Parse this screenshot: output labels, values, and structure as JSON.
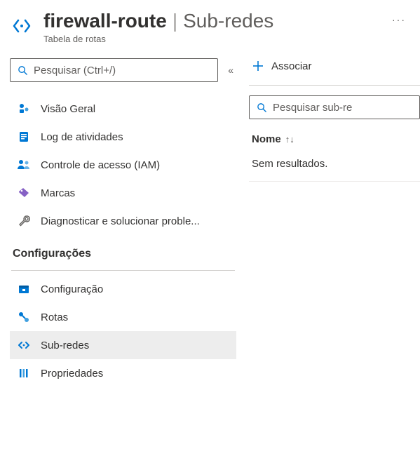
{
  "header": {
    "resource_name": "firewall-route",
    "separator": "|",
    "section": "Sub-redes",
    "subtitle": "Tabela de rotas",
    "more": "···"
  },
  "sidebar": {
    "search_placeholder": "Pesquisar (Ctrl+/)",
    "collapse_glyph": "«",
    "items": [
      {
        "key": "overview",
        "label": "Visão Geral"
      },
      {
        "key": "activity",
        "label": "Log de atividades"
      },
      {
        "key": "iam",
        "label": "Controle de acesso (IAM)"
      },
      {
        "key": "tags",
        "label": "Marcas"
      },
      {
        "key": "diagnose",
        "label": "Diagnosticar e solucionar proble..."
      }
    ],
    "settings_header": "Configurações",
    "settings_items": [
      {
        "key": "config",
        "label": "Configuração"
      },
      {
        "key": "routes",
        "label": "Rotas"
      },
      {
        "key": "subnets",
        "label": "Sub-redes",
        "selected": true
      },
      {
        "key": "properties",
        "label": "Propriedades"
      }
    ]
  },
  "main": {
    "toolbar": {
      "associate_label": "Associar"
    },
    "search_placeholder": "Pesquisar sub-re",
    "table": {
      "col_name": "Nome",
      "sort_glyph": "↑↓",
      "empty": "Sem resultados."
    }
  },
  "colors": {
    "azure_blue": "#0078d4",
    "purple": "#8661c5",
    "grey_icon": "#605e5c"
  }
}
